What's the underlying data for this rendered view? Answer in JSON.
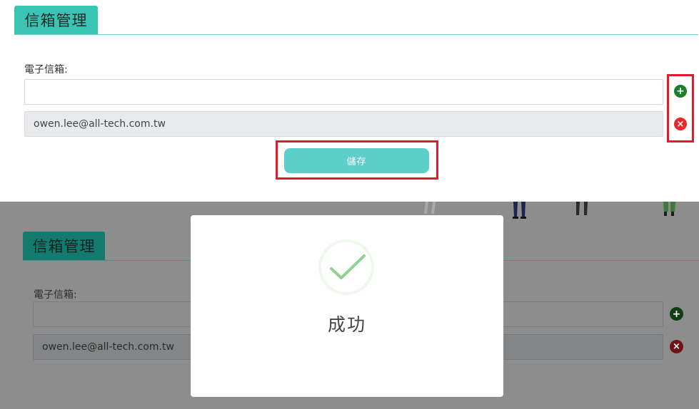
{
  "panel": {
    "title": "信箱管理",
    "email_label": "電子信箱:",
    "new_email_value": "",
    "existing_email": "owen.lee@all-tech.com.tw",
    "add_icon": "+",
    "remove_icon": "×",
    "save_label": "儲存"
  },
  "modal": {
    "message": "成功",
    "icon": "check-icon"
  },
  "colors": {
    "teal_tab": "#39c4b4",
    "save_button": "#5ccfcb",
    "add_green": "#1c7d2c",
    "remove_red": "#e8262c",
    "highlight_red": "#e01b2b",
    "success_check": "#8fd38e"
  }
}
